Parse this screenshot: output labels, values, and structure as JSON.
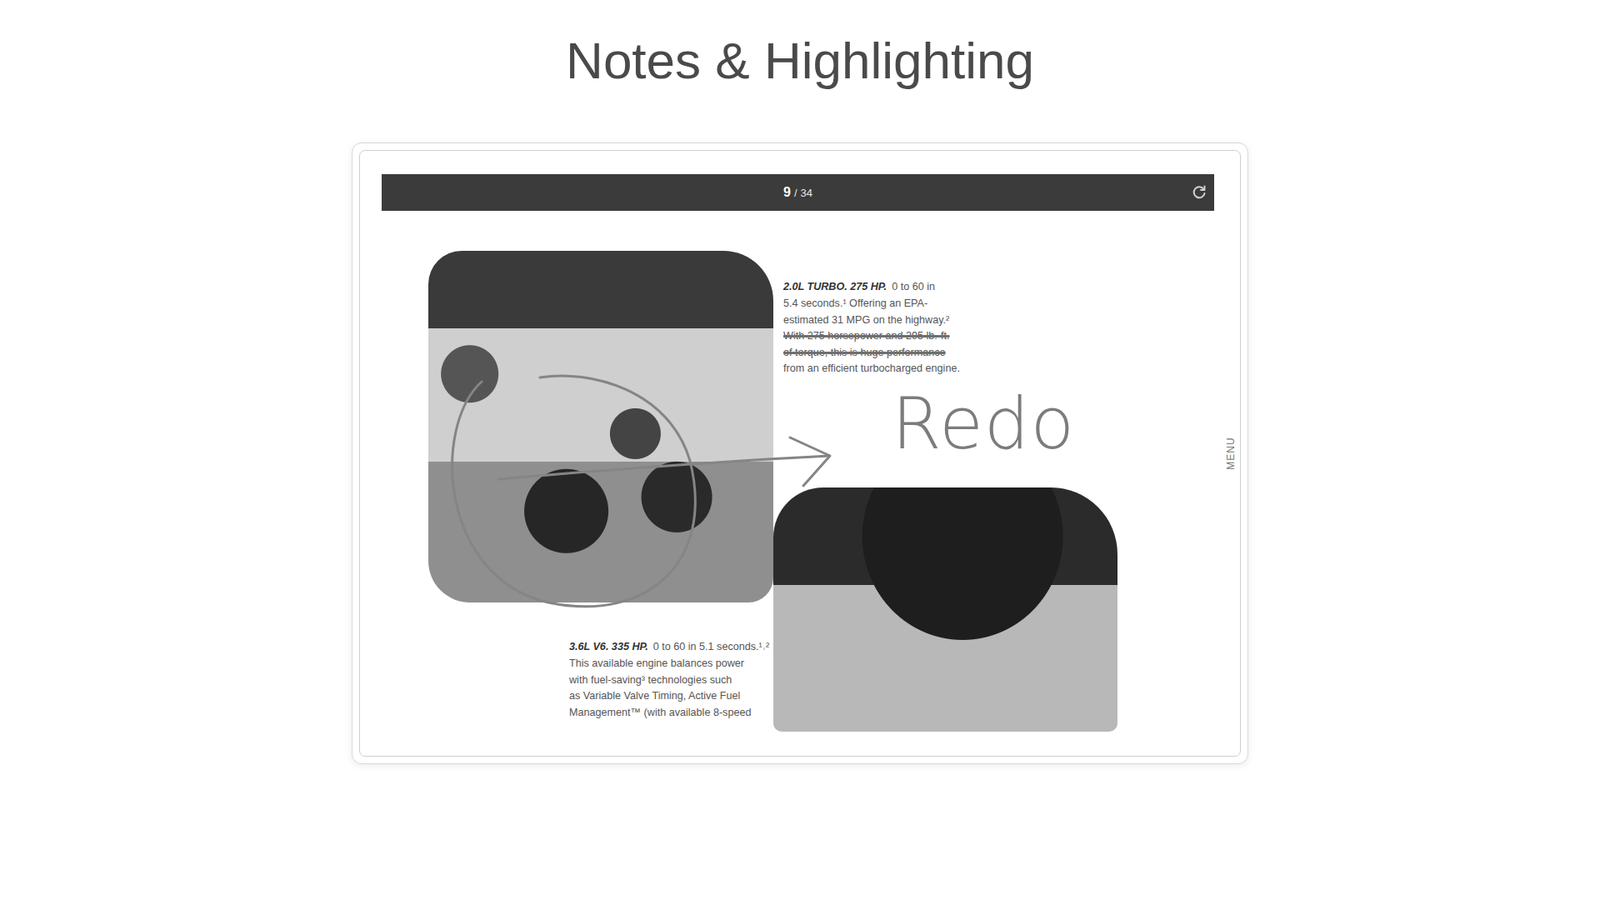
{
  "title": "Notes & Highlighting",
  "reader": {
    "page": "9",
    "separator": "/",
    "total": "34",
    "menu": "MENU"
  },
  "document": {
    "blocks": [
      {
        "heading": "2.0L TURBO. 275 HP.",
        "lines": [
          {
            "text": "0 to 60 in",
            "struck": false
          },
          {
            "text": "5.4 seconds.¹ Offering an EPA-",
            "struck": false
          },
          {
            "text": "estimated 31 MPG on the highway.²",
            "struck": false
          },
          {
            "text": "With 275 horsepower and 295 lb.-ft.",
            "struck": true
          },
          {
            "text": "of torque, this is huge performance",
            "struck": true
          },
          {
            "text": "from an efficient turbocharged engine.",
            "struck": false
          }
        ]
      },
      {
        "heading": "3.6L V6. 335 HP.",
        "lines": [
          {
            "text": "0 to 60 in 5.1 seconds.¹˒²",
            "struck": false
          },
          {
            "text": "This available engine balances power",
            "struck": false
          },
          {
            "text": "with fuel-saving³ technologies such",
            "struck": false
          },
          {
            "text": "as Variable Valve Timing, Active Fuel",
            "struck": false
          },
          {
            "text": "Management™ (with available 8-speed",
            "struck": false
          }
        ]
      }
    ]
  },
  "ink": {
    "note": "Redo"
  }
}
